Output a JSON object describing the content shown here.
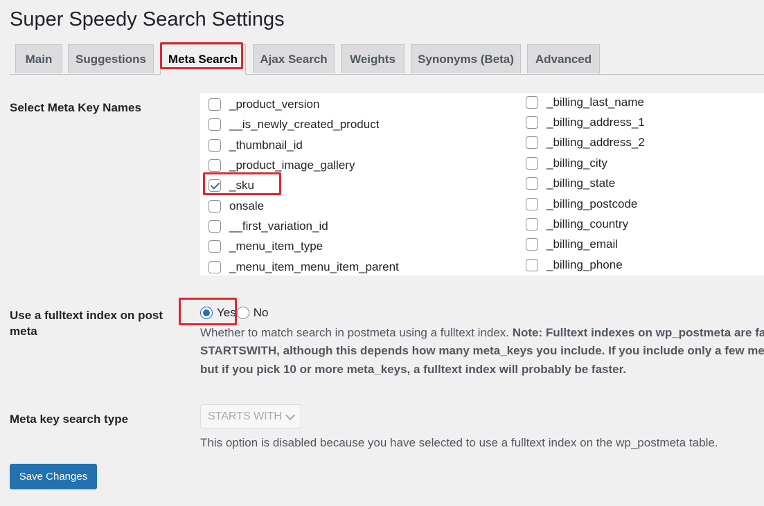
{
  "page_title": "Super Speedy Search Settings",
  "tabs": [
    "Main",
    "Suggestions",
    "Meta Search",
    "Ajax Search",
    "Weights",
    "Synonyms (Beta)",
    "Advanced"
  ],
  "active_tab": "Meta Search",
  "meta_keys": {
    "label": "Select Meta Key Names",
    "column1": [
      {
        "label": "_product_version",
        "checked": false
      },
      {
        "label": "__is_newly_created_product",
        "checked": false
      },
      {
        "label": "_thumbnail_id",
        "checked": false
      },
      {
        "label": "_product_image_gallery",
        "checked": false
      },
      {
        "label": "_sku",
        "checked": true
      },
      {
        "label": "onsale",
        "checked": false
      },
      {
        "label": "__first_variation_id",
        "checked": false
      },
      {
        "label": "_menu_item_type",
        "checked": false
      },
      {
        "label": "_menu_item_menu_item_parent",
        "checked": false
      }
    ],
    "column2": [
      {
        "label": "_billing_last_name",
        "checked": false
      },
      {
        "label": "_billing_address_1",
        "checked": false
      },
      {
        "label": "_billing_address_2",
        "checked": false
      },
      {
        "label": "_billing_city",
        "checked": false
      },
      {
        "label": "_billing_state",
        "checked": false
      },
      {
        "label": "_billing_postcode",
        "checked": false
      },
      {
        "label": "_billing_country",
        "checked": false
      },
      {
        "label": "_billing_email",
        "checked": false
      },
      {
        "label": "_billing_phone",
        "checked": false
      }
    ]
  },
  "fulltext": {
    "label_line1": "Use a fulltext index on post",
    "label_line2": "meta",
    "yes_label": "Yes",
    "no_label": "No",
    "selected": "Yes",
    "desc_line1_plain": "Whether to match search in postmeta using a fulltext index. ",
    "desc_line1_bold": "Note: Fulltext indexes on wp_postmeta are fa",
    "desc_line2": "STARTSWITH, although this depends how many meta_keys you include. If you include only a few meta_",
    "desc_line3": "but if you pick 10 or more meta_keys, a fulltext index will probably be faster."
  },
  "search_type": {
    "label": "Meta key search type",
    "value": "STARTS WITH",
    "disabled_note": "This option is disabled because you have selected to use a fulltext index on the wp_postmeta table."
  },
  "save_button": "Save Changes",
  "colors": {
    "accent": "#2271b1",
    "highlight": "#e0282e"
  },
  "icons": {
    "select_arrow": "chevron-down-icon",
    "checkmark": "check-icon"
  }
}
